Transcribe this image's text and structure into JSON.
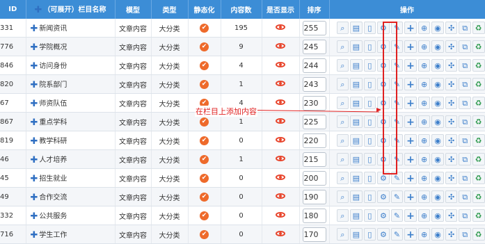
{
  "headers": {
    "id": "ID",
    "name": "（可展开）栏目名称",
    "model": "模型",
    "type": "类型",
    "static": "静态化",
    "count": "内容数",
    "visible": "是否显示",
    "sort": "排序",
    "ops": "操作"
  },
  "rows": [
    {
      "id": "331",
      "name": "新闻资讯",
      "model": "文章内容",
      "type": "大分类",
      "count": "195",
      "sort": "255"
    },
    {
      "id": "776",
      "name": "学院概况",
      "model": "文章内容",
      "type": "大分类",
      "count": "9",
      "sort": "245"
    },
    {
      "id": "846",
      "name": "访问身份",
      "model": "文章内容",
      "type": "大分类",
      "count": "4",
      "sort": "244"
    },
    {
      "id": "820",
      "name": "院系部门",
      "model": "文章内容",
      "type": "大分类",
      "count": "1",
      "sort": "243"
    },
    {
      "id": "67",
      "name": "师资队伍",
      "model": "文章内容",
      "type": "大分类",
      "count": "4",
      "sort": "230"
    },
    {
      "id": "867",
      "name": "重点学科",
      "model": "文章内容",
      "type": "大分类",
      "count": "1",
      "sort": "225"
    },
    {
      "id": "819",
      "name": "教学科研",
      "model": "文章内容",
      "type": "大分类",
      "count": "0",
      "sort": "220"
    },
    {
      "id": "46",
      "name": "人才培养",
      "model": "文章内容",
      "type": "大分类",
      "count": "1",
      "sort": "215"
    },
    {
      "id": "45",
      "name": "招生就业",
      "model": "文章内容",
      "type": "大分类",
      "count": "0",
      "sort": "200"
    },
    {
      "id": "49",
      "name": "合作交流",
      "model": "文章内容",
      "type": "大分类",
      "count": "0",
      "sort": "190"
    },
    {
      "id": "332",
      "name": "公共服务",
      "model": "文章内容",
      "type": "大分类",
      "count": "0",
      "sort": "180"
    },
    {
      "id": "716",
      "name": "学生工作",
      "model": "文章内容",
      "type": "大分类",
      "count": "0",
      "sort": "170"
    }
  ],
  "op_icons": [
    {
      "name": "search-icon",
      "glyph": "⌕",
      "color": "blue"
    },
    {
      "name": "list-icon",
      "glyph": "▤",
      "color": "blue"
    },
    {
      "name": "mobile-icon",
      "glyph": "▯",
      "color": "blue"
    },
    {
      "name": "gear-icon",
      "glyph": "⚙",
      "color": "blue"
    },
    {
      "name": "edit-icon",
      "glyph": "✎",
      "color": "blue"
    },
    {
      "name": "add-icon",
      "glyph": "+",
      "color": "blue"
    },
    {
      "name": "add-content-icon",
      "glyph": "⊕",
      "color": "blue"
    },
    {
      "name": "globe-icon",
      "glyph": "◉",
      "color": "blue"
    },
    {
      "name": "move-icon",
      "glyph": "✣",
      "color": "blue"
    },
    {
      "name": "copy-icon",
      "glyph": "⧉",
      "color": "blue"
    },
    {
      "name": "recycle-icon",
      "glyph": "♻",
      "color": "green"
    }
  ],
  "annotation": "在栏目上添加内容",
  "colors": {
    "header_bg": "#3c8dd6",
    "accent_red": "#e02020",
    "check_orange": "#ee6a2b"
  }
}
